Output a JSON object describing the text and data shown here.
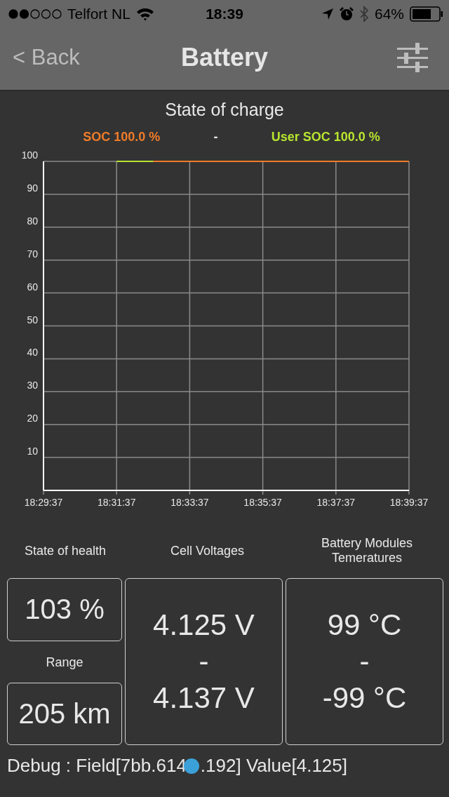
{
  "status_bar": {
    "carrier": "Telfort NL",
    "time": "18:39",
    "battery": "64%"
  },
  "nav_bar": {
    "back": "< Back",
    "title": "Battery"
  },
  "chart": {
    "title": "State of charge",
    "legend_separator": "-",
    "chart_data": {
      "type": "line",
      "categories": [
        "18:29:37",
        null,
        "18:31:37",
        null,
        "18:33:37",
        null,
        "18:35:37",
        null,
        "18:37:37",
        null,
        "18:39:37"
      ],
      "series": [
        {
          "name": "SOC 100.0 %",
          "color": "#f07c28",
          "values": [
            null,
            null,
            null,
            100,
            100,
            100,
            100,
            100,
            100,
            100,
            100
          ]
        },
        {
          "name": "User SOC 100.0 %",
          "color": "#b8e62e",
          "values": [
            null,
            null,
            100,
            100,
            null,
            null,
            null,
            null,
            null,
            null,
            null
          ]
        }
      ],
      "ylim": [
        0,
        100
      ],
      "grid": true,
      "yticks": [
        10,
        20,
        30,
        40,
        50,
        60,
        70,
        80,
        90,
        100
      ]
    }
  },
  "panels": {
    "health_label": "State of health",
    "health_value": "103 %",
    "range_label": "Range",
    "range_value": "205 km",
    "cells_label": "Cell Voltages",
    "cells_high": "4.125 V",
    "cells_sep": "-",
    "cells_low": "4.137 V",
    "temps_label": "Battery Modules Temeratures",
    "temps_high": "99 °C",
    "temps_sep": "-",
    "temps_low": "-99 °C"
  },
  "debug": {
    "before": "Debug : Field[7bb.614",
    "after": ".192] Value[4.125]"
  }
}
